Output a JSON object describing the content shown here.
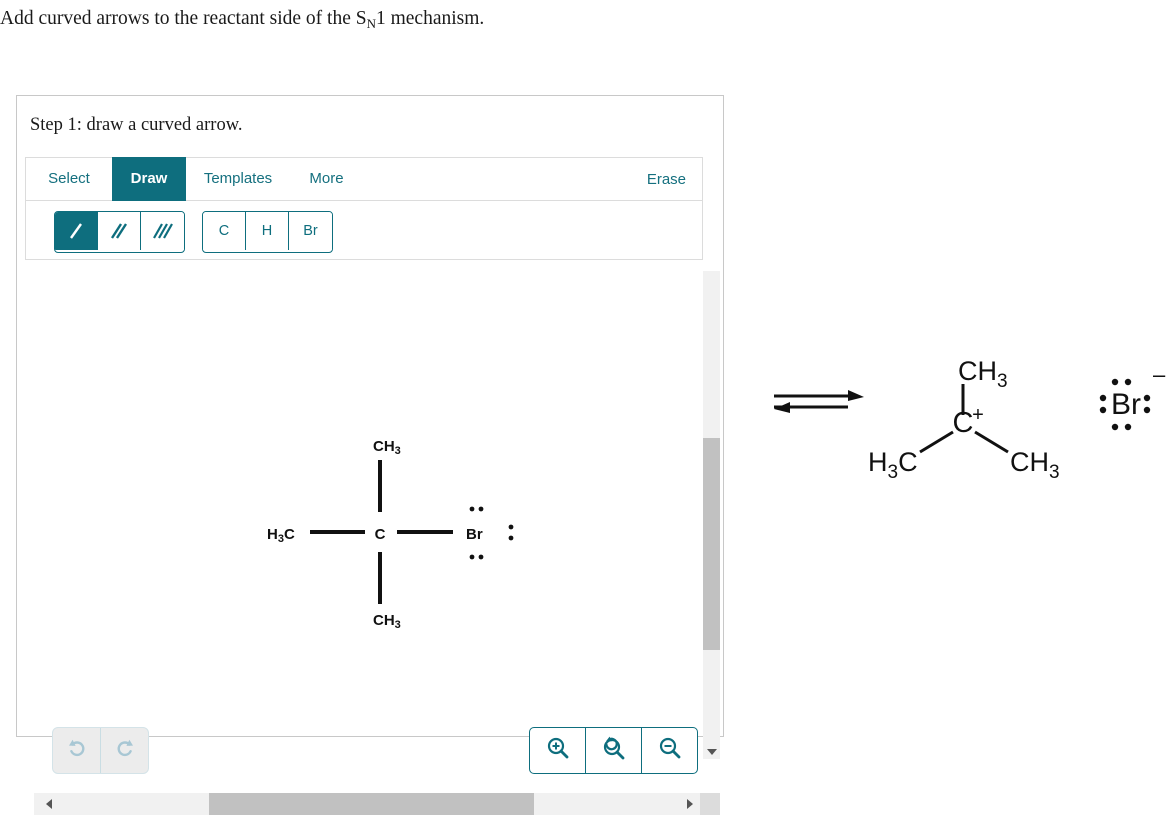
{
  "prompt": {
    "text_before": "Add curved arrows to the reactant side of the S",
    "subscript": "N",
    "text_after": "1 mechanism."
  },
  "editor": {
    "step_label": "Step 1: draw a curved arrow.",
    "tabs": [
      {
        "id": "select",
        "label": "Select",
        "active": false
      },
      {
        "id": "draw",
        "label": "Draw",
        "active": true
      },
      {
        "id": "templates",
        "label": "Templates",
        "active": false
      },
      {
        "id": "more",
        "label": "More",
        "active": false
      }
    ],
    "erase_label": "Erase",
    "bond_tools": [
      {
        "id": "single-bond",
        "icon": "single-bond-icon",
        "active": true
      },
      {
        "id": "double-bond",
        "icon": "double-bond-icon",
        "active": false
      },
      {
        "id": "triple-bond",
        "icon": "triple-bond-icon",
        "active": false
      }
    ],
    "atom_tools": [
      {
        "id": "carbon",
        "label": "C"
      },
      {
        "id": "hydrogen",
        "label": "H"
      },
      {
        "id": "bromine",
        "label": "Br"
      }
    ],
    "history_buttons": [
      {
        "id": "undo",
        "icon": "undo-icon"
      },
      {
        "id": "redo",
        "icon": "redo-icon"
      }
    ],
    "zoom_buttons": [
      {
        "id": "zoom-in",
        "icon": "zoom-in-icon"
      },
      {
        "id": "zoom-reset",
        "icon": "zoom-reset-icon"
      },
      {
        "id": "zoom-out",
        "icon": "zoom-out-icon"
      }
    ]
  },
  "canvas_structure": {
    "name": "tert-butyl bromide",
    "center_atom": "C",
    "top_group": "CH3",
    "top_group_base": "CH",
    "top_group_sub": "3",
    "bottom_group": "CH3",
    "bottom_group_base": "CH",
    "bottom_group_sub": "3",
    "left_group": "H3C",
    "left_group_sub": "3",
    "left_group_pre": "H",
    "left_group_post": "C",
    "right_atom": "Br",
    "right_atom_lone_pairs": 3
  },
  "reaction": {
    "arrow_type": "equilibrium",
    "cation": {
      "center_atom": "C",
      "charge": "+",
      "top_group_base": "CH",
      "top_group_sub": "3",
      "left_group_pre": "H",
      "left_group_sub": "3",
      "left_group_post": "C",
      "right_group_base": "CH",
      "right_group_sub": "3"
    },
    "anion": {
      "atom": "Br",
      "charge": "–",
      "lone_pairs": 4
    }
  },
  "colors": {
    "teal": "#0e6e7e",
    "panel_border": "#c8c8c8",
    "scroll_track": "#f1f1f1",
    "scroll_thumb": "#c1c1c1",
    "structure_black": "#111111"
  }
}
